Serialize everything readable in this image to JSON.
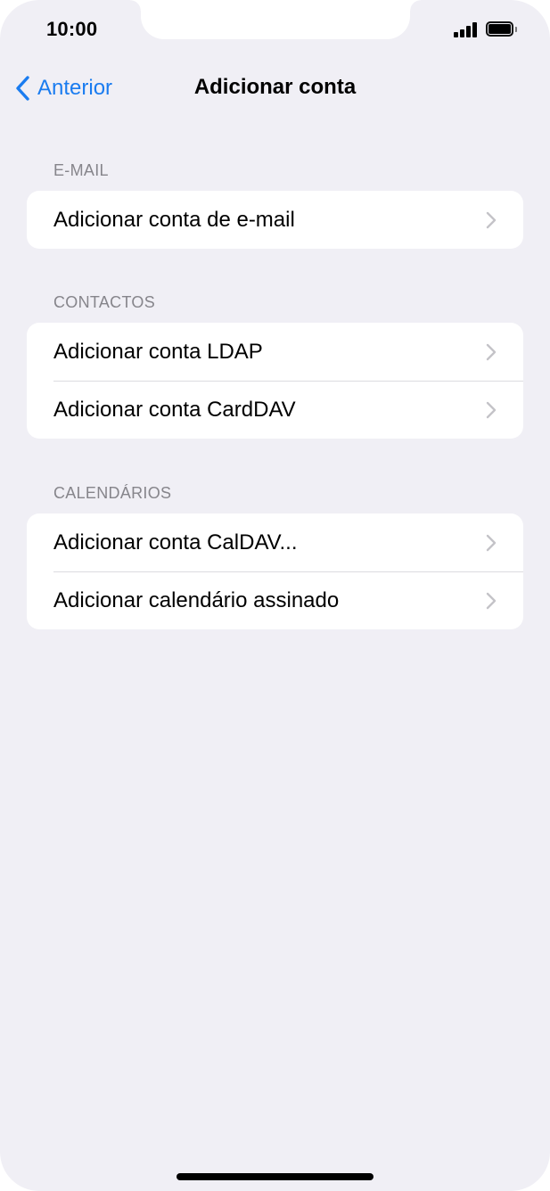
{
  "status_bar": {
    "time": "10:00",
    "signal_icon": "cellular-signal-icon",
    "battery_icon": "battery-icon"
  },
  "nav": {
    "back_label": "Anterior",
    "back_icon": "chevron-left-icon",
    "title": "Adicionar conta"
  },
  "colors": {
    "accent": "#1a7cf0",
    "background": "#f0eff5",
    "section_header": "#86858b"
  },
  "sections": [
    {
      "header": "E-MAIL",
      "items": [
        {
          "label": "Adicionar conta de e-mail"
        }
      ]
    },
    {
      "header": "CONTACTOS",
      "items": [
        {
          "label": "Adicionar conta LDAP"
        },
        {
          "label": "Adicionar conta CardDAV"
        }
      ]
    },
    {
      "header": "CALENDÁRIOS",
      "items": [
        {
          "label": "Adicionar conta CalDAV..."
        },
        {
          "label": "Adicionar calendário assinado"
        }
      ]
    }
  ]
}
